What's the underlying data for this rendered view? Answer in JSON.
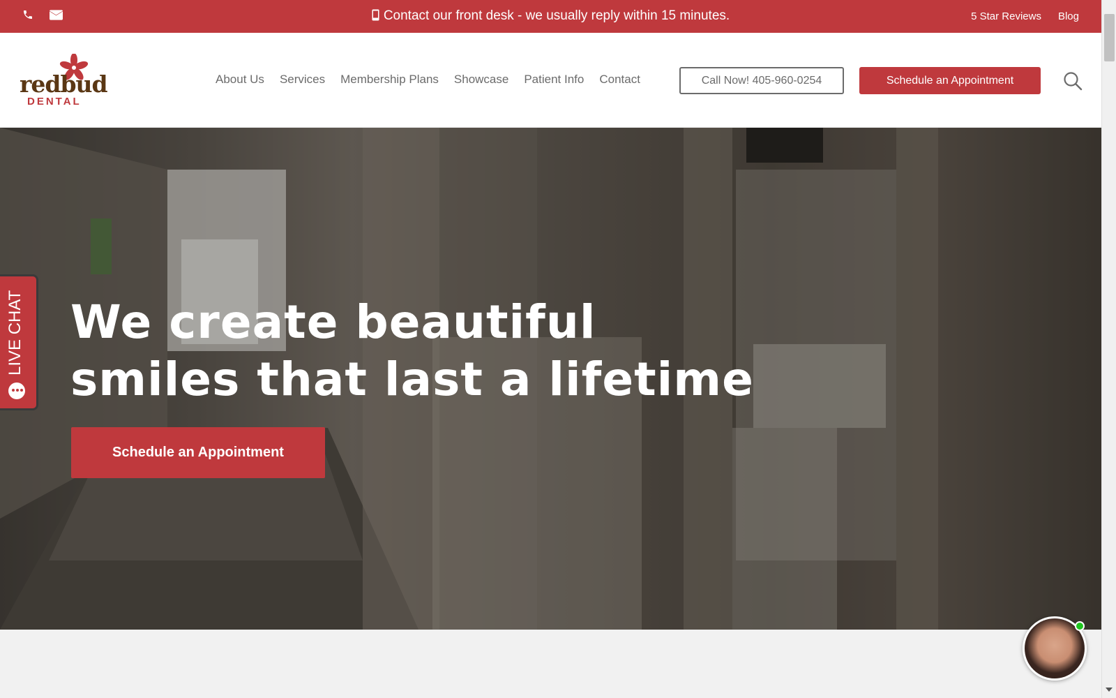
{
  "topbar": {
    "notice": "Contact our front desk - we usually reply within 15 minutes.",
    "links": [
      "5 Star Reviews",
      "Blog"
    ],
    "icons": [
      "phone-icon",
      "envelope-icon",
      "mobile-icon"
    ]
  },
  "logo": {
    "word": "redbud",
    "sub": "DENTAL"
  },
  "nav": {
    "items": [
      "About Us",
      "Services",
      "Membership Plans",
      "Showcase",
      "Patient Info",
      "Contact"
    ],
    "call_button": "Call Now! 405-960-0254",
    "schedule_button": "Schedule an Appointment"
  },
  "hero": {
    "headline_line1": "We create beautiful",
    "headline_line2": "smiles that last a lifetime",
    "cta": "Schedule an Appointment"
  },
  "livechat": {
    "label": "LIVE CHAT"
  },
  "colors": {
    "brand_red": "#bf393d",
    "nav_text": "#6b6b6b",
    "logo_brown": "#5a3714",
    "online_green": "#1ec51e"
  }
}
